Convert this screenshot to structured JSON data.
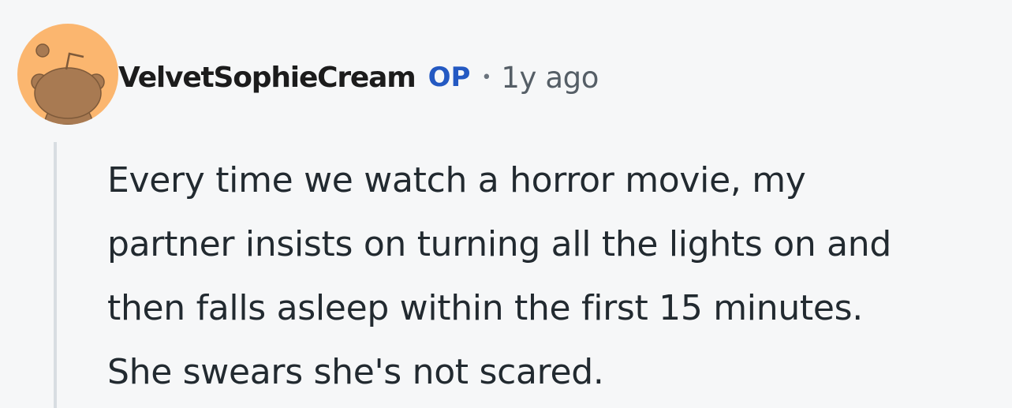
{
  "comment": {
    "author": "VelvetSophieCream",
    "op_badge": "OP",
    "separator": "•",
    "timestamp": "1y ago",
    "avatar_icon": "reddit-snoo-avatar-icon",
    "colors": {
      "avatar_bg": "#fbb66f",
      "avatar_figure": "#a87a52",
      "op": "#2459c2",
      "thread_line": "#d8dde2"
    },
    "body_lines": [
      "Every time we watch a horror movie, my",
      "partner insists on turning all the lights on and",
      "then falls asleep within the first 15 minutes.",
      "She swears she's not scared."
    ]
  }
}
